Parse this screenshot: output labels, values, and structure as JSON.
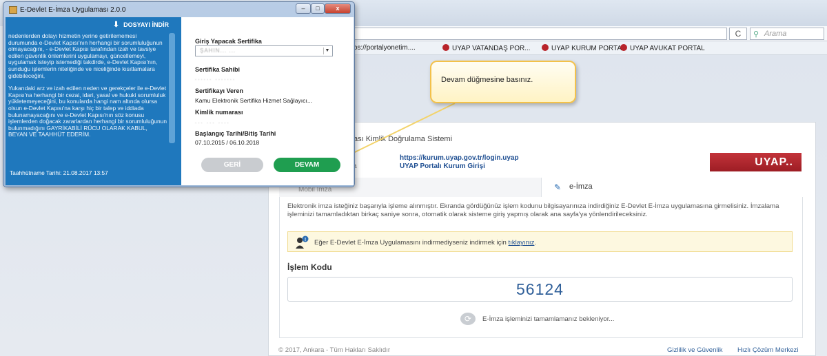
{
  "browser": {
    "search_placeholder": "Arama",
    "reload_glyph": "C",
    "bookmarks": [
      {
        "label": "tps://portalyonetim...."
      },
      {
        "label": "UYAP VATANDAŞ POR..."
      },
      {
        "label": "UYAP KURUM PORTAL"
      },
      {
        "label": "UYAP AVUKAT PORTAL"
      }
    ]
  },
  "callout": {
    "text": "Devam düğmesine basınız."
  },
  "page": {
    "title": "ası Kimlik Doğrulama Sistemi",
    "link_url": "https://kurum.uyap.gov.tr/login.uyap",
    "link_label": "UYAP Portalı Kurum Girişi",
    "partial_a": "a",
    "logo_text": "UYAP..",
    "tab_mobile": "Mobil İmza",
    "tab_eimza": "e-İmza",
    "description": "Elektronik imza isteğiniz başarıyla işleme alınmıştır. Ekranda gördüğünüz işlem kodunu bilgisayarınıza indirdiğiniz E-Devlet E-İmza uygulamasına girmelisiniz. İmzalama işleminizi tamamladıktan birkaç saniye sonra, otomatik olarak sisteme giriş yapmış olarak ana sayfa'ya yönlendirileceksiniz.",
    "notice_text": "Eğer E-Devlet E-İmza Uygulamasını indirmediyseniz indirmek için",
    "notice_link": "tıklayınız",
    "notice_end": ".",
    "code_label": "İşlem Kodu",
    "code_value": "56124",
    "waiting_text": "E-İmza işleminizi tamamlamanız bekleniyor...",
    "footer_copyright": "© 2017, Ankara - Tüm Hakları Saklıdır",
    "footer_privacy": "Gizlilik ve Güvenlik",
    "footer_help": "Hızlı Çözüm Merkezi"
  },
  "dialog": {
    "title": "E-Devlet E-İmza Uygulaması 2.0.0",
    "minimize": "–",
    "maximize": "□",
    "close": "x",
    "download_label": "DOSYAYI İNDİR",
    "legal_p1": "nedenlerden dolayı hizmetin yerine getirilememesi durumunda e-Devlet Kapısı'nın herhangi bir sorumluluğunun olmayacağını, - e-Devlet Kapısı tarafından izah ve tavsiye edilen güvenlik önlemlerini uygulamayı, güncellemeyi, uygulamak isteyip istemediği takdirde, e-Devlet Kapısı'nın, sunduğu işlemlerin niteliğinde ve niceliğinde kısıtlamalara gidebileceğini,",
    "legal_p2": "Yukarıdaki arz ve izah edilen neden ve gerekçeler ile e-Devlet Kapısı'na herhangi bir cezai, idari, yasal ve hukuki sorumluluk yükletemeyeceğini, bu konularda hangi nam altında olursa olsun e-Devlet Kapısı'na karşı hiç bir talep ve iddiada bulunamayacağını ve e-Devlet Kapısı'nın söz konusu işlemlerden doğacak zararlardan herhangi bir sorumluluğunun bulunmadığını GAYRİKABİLİ RÜCU OLARAK KABUL, BEYAN VE TAAHHÜT EDERİM.",
    "commitment_date": "Taahhütname Tarihi: 21.08.2017 13:57",
    "cert_label": "Giriş Yapacak Sertifika",
    "cert_value": "ŞAHIN... ...",
    "owner_label": "Sertifika Sahibi",
    "owner_value": "...... .......",
    "issuer_label": "Sertifikayı Veren",
    "issuer_value": "Kamu Elektronik Sertifika Hizmet Sağlayıcı...",
    "id_label": "Kimlik numarası",
    "id_value": "... ... ....",
    "dates_label": "Başlangıç Tarihi/Bitiş Tarihi",
    "dates_value": "07.10.2015 / 06.10.2018",
    "back_button": "GERİ",
    "continue_button": "DEVAM"
  }
}
